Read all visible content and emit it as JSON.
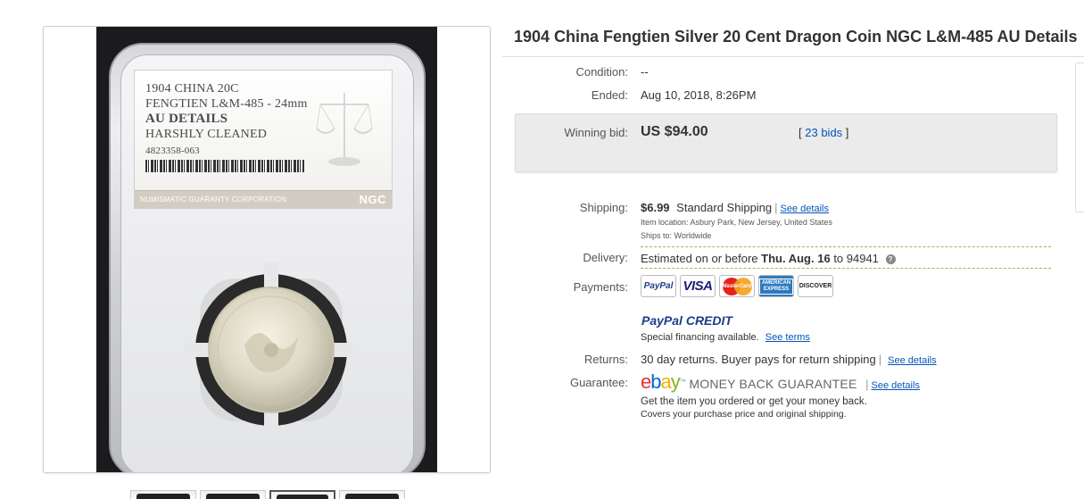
{
  "listing": {
    "title": "1904 China Fengtien Silver 20 Cent Dragon Coin NGC L&M-485 AU Details"
  },
  "slab_label": {
    "line1": "1904 CHINA 20C",
    "line2": "FENGTIEN L&M-485 - 24mm",
    "line3": "AU DETAILS",
    "line4": "HARSHLY CLEANED",
    "serial": "4823358-063",
    "corporation": "NUMISMATIC GUARANTY CORPORATION",
    "logo": "NGC"
  },
  "details": {
    "condition_label": "Condition:",
    "condition_value": "--",
    "ended_label": "Ended:",
    "ended_date": "Aug 10, 2018",
    "ended_time": "8:26PM",
    "winning_bid_label": "Winning bid:",
    "winning_bid_value": "US $94.00",
    "bids_open": "[",
    "bids_link": "23 bids",
    "bids_close": "]",
    "shipping_label": "Shipping:",
    "shipping_cost": "$6.99",
    "shipping_method": "Standard Shipping",
    "shipping_see_details": "See details",
    "item_location_label": "Item location:",
    "item_location": "Asbury Park, New Jersey, United States",
    "ships_to_label": "Ships to:",
    "ships_to": "Worldwide",
    "delivery_label": "Delivery:",
    "delivery_prefix": "Estimated on or before",
    "delivery_date": "Thu. Aug. 16",
    "delivery_to": "to 94941",
    "payments_label": "Payments:",
    "payment_methods": {
      "paypal": "PayPal",
      "visa": "VISA",
      "mastercard": "MasterCard",
      "amex": "AMERICAN EXPRESS",
      "discover": "DISCOVER"
    },
    "paypal_credit_1": "PayPal",
    "paypal_credit_2": "CREDIT",
    "financing_text": "Special financing available.",
    "financing_link": "See terms",
    "returns_label": "Returns:",
    "returns_value": "30 day returns. Buyer pays for return shipping",
    "returns_link": "See details",
    "guarantee_label": "Guarantee:",
    "guarantee_brand": "MONEY BACK GUARANTEE",
    "guarantee_link": "See details",
    "guarantee_line1": "Get the item you ordered or get your money back.",
    "guarantee_line2": "Covers your purchase price and original shipping."
  },
  "colors": {
    "link": "#0654ba",
    "dashed_divider": "#8ac341",
    "bid_box_bg": "#ebebeb"
  },
  "icons": [
    "help-icon"
  ]
}
